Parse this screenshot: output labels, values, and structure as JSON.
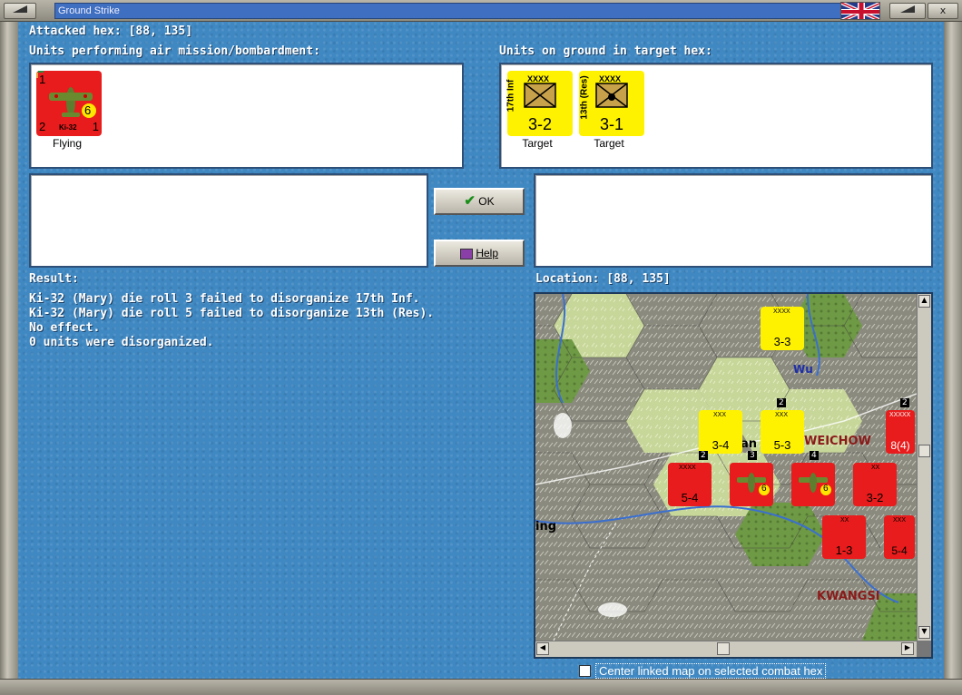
{
  "window": {
    "title": "Ground Strike",
    "min_label": "",
    "close_label": "x"
  },
  "attacked": {
    "label": "Attacked hex:",
    "coords": "[88, 135]"
  },
  "air_units": {
    "heading": "Units performing air mission/bombardment:",
    "units": [
      {
        "name": "Ki-32",
        "attack": "1",
        "defence": "2",
        "range": "1",
        "bomb": "6",
        "status": "Flying",
        "color": "#e81c1c"
      }
    ]
  },
  "ground_units": {
    "heading": "Units on ground in target hex:",
    "units": [
      {
        "name": "17th Inf",
        "size": "XXXX",
        "strength": "3-2",
        "status": "Target",
        "color": "#fff200"
      },
      {
        "name": "13th (Res)",
        "size": "XXXX",
        "strength": "3-1",
        "status": "Target",
        "color": "#fff200"
      }
    ]
  },
  "buttons": {
    "ok": "OK",
    "help": "Help"
  },
  "result": {
    "heading": "Result:",
    "lines": [
      "Ki-32 (Mary) die roll 3 failed to disorganize 17th Inf.",
      "Ki-32 (Mary) die roll 5 failed to disorganize 13th (Res).",
      "No effect.",
      "0 units were disorganized."
    ]
  },
  "location": {
    "label": "Location:",
    "coords": "[88, 135]"
  },
  "map": {
    "labels": {
      "weichow": "WEICHOW",
      "kwangsi": "KWANGSI",
      "wu": "Wu",
      "lan": "an",
      "ning": "ing"
    },
    "counters": [
      {
        "size": "XXXX",
        "strength": "3-3",
        "color": "#fff200"
      },
      {
        "size": "XXX",
        "strength": "3-4",
        "color": "#fff200"
      },
      {
        "size": "XXX",
        "strength": "5-3",
        "color": "#fff200"
      },
      {
        "size": "XXXXX",
        "strength": "8(4)",
        "color": "#e81c1c"
      },
      {
        "size": "XXXX",
        "strength": "5-4",
        "color": "#e81c1c"
      },
      {
        "size": "",
        "strength": "6",
        "color": "#e81c1c"
      },
      {
        "size": "",
        "strength": "6",
        "color": "#e81c1c"
      },
      {
        "size": "XX",
        "strength": "3-2",
        "color": "#e81c1c"
      },
      {
        "size": "XX",
        "strength": "1-3",
        "color": "#e81c1c"
      },
      {
        "size": "XXX",
        "strength": "5-4",
        "color": "#e81c1c"
      }
    ],
    "stack_counts": [
      "2",
      "2",
      "3",
      "4",
      "2"
    ]
  },
  "checkbox": {
    "label": "Center linked map on selected combat hex",
    "checked": false
  },
  "colors": {
    "sea": "#3f88c2",
    "axis_red": "#e81c1c",
    "allied_yellow": "#fff200"
  }
}
